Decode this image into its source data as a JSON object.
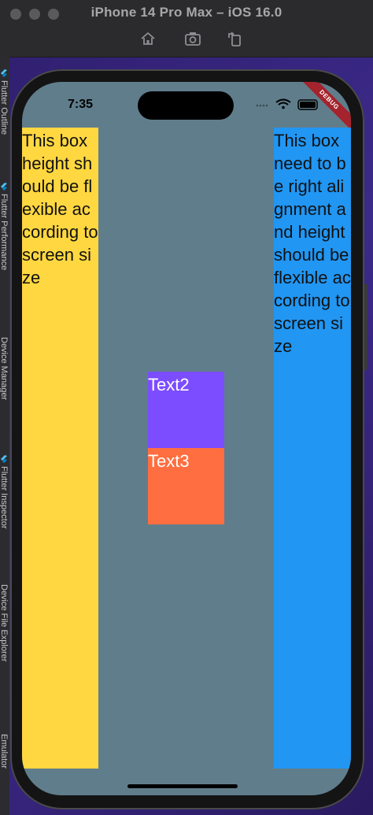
{
  "window": {
    "title": "iPhone 14 Pro Max – iOS 16.0"
  },
  "toolbar": {
    "icons": [
      "home-icon",
      "screenshot-icon",
      "rotate-icon"
    ]
  },
  "ide_sidebar": {
    "items": [
      "Flutter Outline",
      "Flutter Performance",
      "Device Manager",
      "Flutter Inspector",
      "Device File Explorer",
      "Emulator"
    ]
  },
  "status_bar": {
    "time": "7:35",
    "debug_banner": "DEBUG"
  },
  "app": {
    "left_box_text": "This box height should be flexible according to screen size",
    "right_box_text": "This box need to be right alignment and height should be flexible according to screen size",
    "text2": "Text2",
    "text3": "Text3"
  },
  "colors": {
    "background": "#607d8b",
    "left_box": "#ffd740",
    "right_box": "#2196f3",
    "text2_box": "#7c4dff",
    "text3_box": "#ff6e40"
  }
}
